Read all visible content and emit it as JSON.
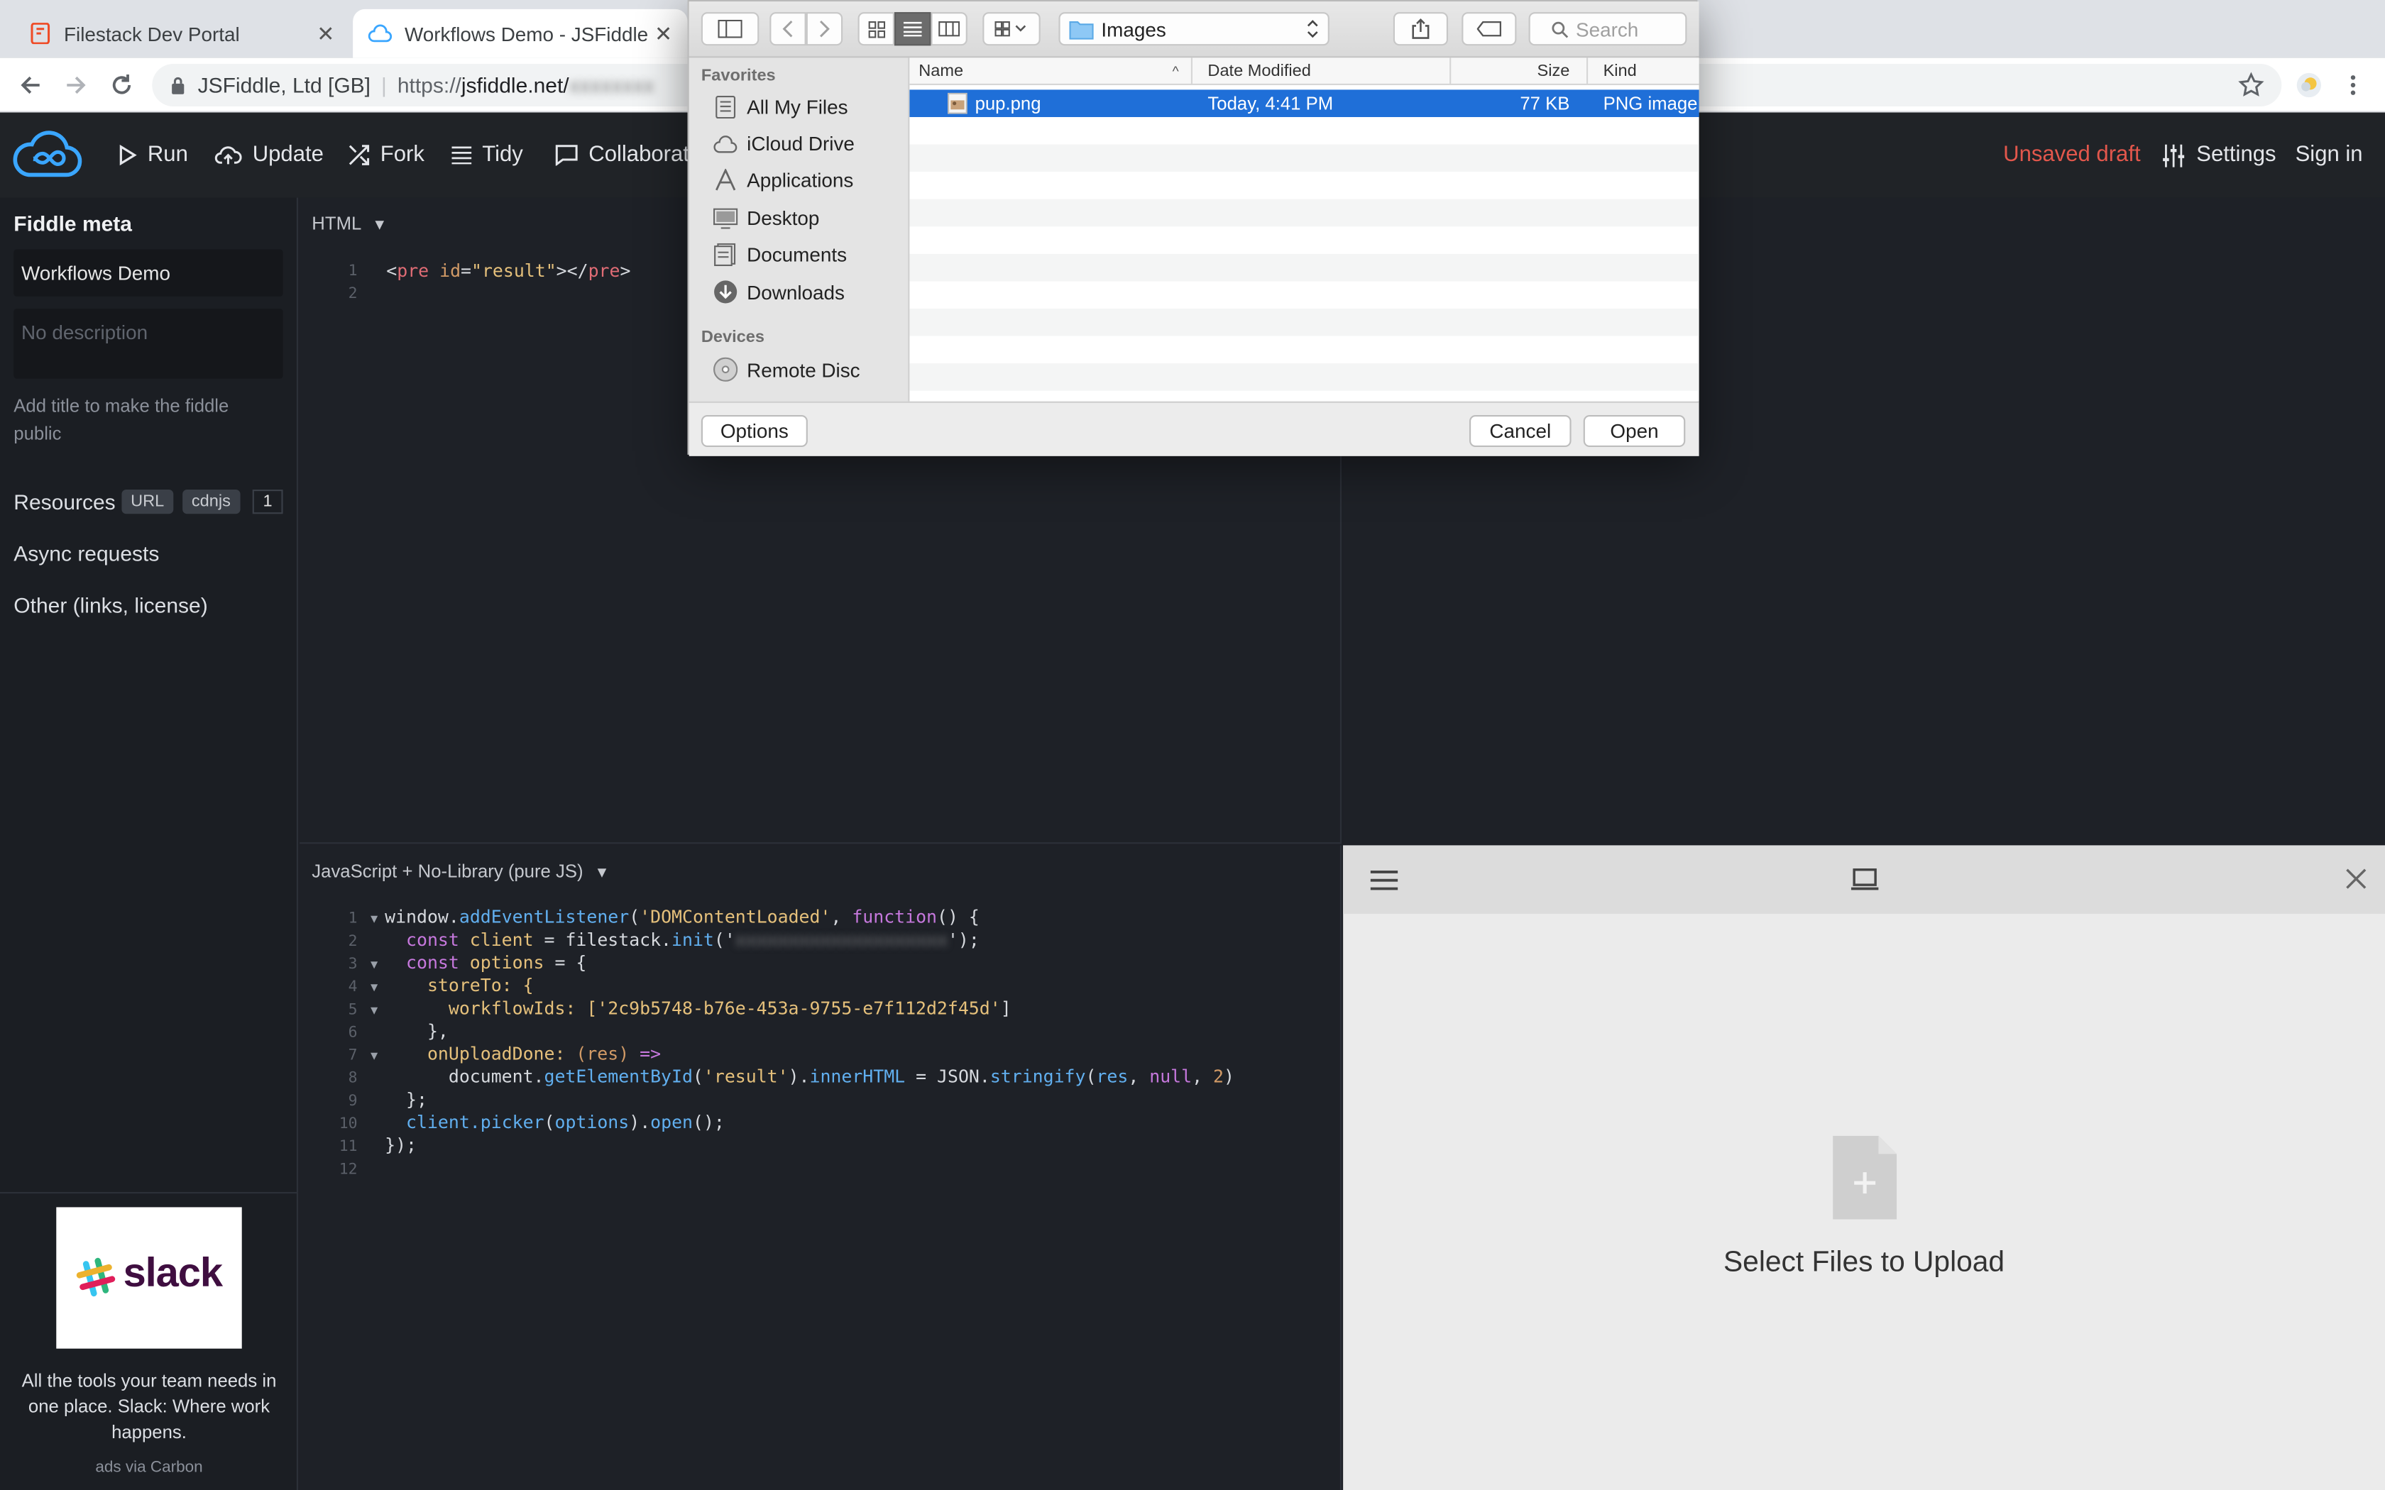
{
  "browser": {
    "tabs": [
      {
        "title": "Filestack Dev Portal",
        "active": false
      },
      {
        "title": "Workflows Demo - JSFiddle",
        "active": true
      }
    ],
    "site_identity": "JSFiddle, Ltd [GB]",
    "url_prefix": "https://",
    "url_host": "jsfiddle.net/",
    "url_path_blurred": "xxxxxxxx"
  },
  "header": {
    "run": "Run",
    "update": "Update",
    "fork": "Fork",
    "tidy": "Tidy",
    "collaborate": "Collaborate",
    "unsaved": "Unsaved draft",
    "settings": "Settings",
    "signin": "Sign in",
    "colors": {
      "unsaved": "#e2574c",
      "bg": "#202327",
      "logo": "#3aa6ff"
    }
  },
  "sidebar": {
    "title": "Fiddle meta",
    "name_value": "Workflows Demo",
    "description_placeholder": "No description",
    "hint": "Add title to make the fiddle public",
    "resources_label": "Resources",
    "url_pill": "URL",
    "cdnjs_pill": "cdnjs",
    "resources_count": "1",
    "async": "Async requests",
    "other": "Other (links, license)",
    "ad_text": "All the tools your team needs in one place. Slack: Where work happens.",
    "ad_via": "ads via Carbon",
    "ad_logo_text": "slack"
  },
  "html_panel": {
    "label": "HTML",
    "lines": [
      "1",
      "2"
    ],
    "code": {
      "open_lt": "<",
      "tag": "pre",
      "attr": " id",
      "eq": "=",
      "str": "\"result\"",
      "close": "></",
      "tag2": "pre",
      "end": ">"
    }
  },
  "js_panel": {
    "label": "JavaScript + No-Library (pure JS)",
    "line_numbers": [
      "1",
      "2",
      "3",
      "4",
      "5",
      "6",
      "7",
      "8",
      "9",
      "10",
      "11",
      "12"
    ],
    "code": {
      "l1a": "window.",
      "l1b": "addEventListener",
      "l1c": "(",
      "l1d": "'DOMContentLoaded'",
      "l1e": ", ",
      "l1f": "function",
      "l1g": "() {",
      "l2a": "  const ",
      "l2b": "client",
      "l2c": " = filestack.",
      "l2d": "init",
      "l2e": "('",
      "l2f": "xxxxxxxxxxxxxxxxxxxx",
      "l2g": "');",
      "l3a": "  const ",
      "l3b": "options",
      "l3c": " = {",
      "l4": "    storeTo: {",
      "l5a": "      workflowIds: [",
      "l5b": "'2c9b5748-b76e-453a-9755-e7f112d2f45d'",
      "l5c": "]",
      "l6": "    },",
      "l7a": "    onUploadDone: ",
      "l7b": "(res)",
      "l7c": " =>",
      "l8a": "      document.",
      "l8b": "getElementById",
      "l8c": "(",
      "l8d": "'result'",
      "l8e": ").",
      "l8f": "innerHTML",
      "l8g": " = ",
      "l8h": "JSON.",
      "l8i": "stringify",
      "l8j": "(",
      "l8k": "res",
      "l8l": ", ",
      "l8m": "null",
      "l8n": ", ",
      "l8o": "2",
      "l8p": ")",
      "l9": "  };",
      "l10a": "  client.",
      "l10b": "picker",
      "l10c": "(",
      "l10d": "options",
      "l10e": ").",
      "l10f": "open",
      "l10g": "();",
      "l11": "});"
    }
  },
  "picker": {
    "select_text": "Select Files to Upload"
  },
  "file_dialog": {
    "location": "Images",
    "search_placeholder": "Search",
    "favorites_header": "Favorites",
    "favorites": [
      "All My Files",
      "iCloud Drive",
      "Applications",
      "Desktop",
      "Documents",
      "Downloads"
    ],
    "devices_header": "Devices",
    "devices": [
      "Remote Disc"
    ],
    "columns": [
      "Name",
      "Date Modified",
      "Size",
      "Kind"
    ],
    "files": [
      {
        "name": "pup.png",
        "modified": "Today, 4:41 PM",
        "size": "77 KB",
        "kind": "PNG image",
        "selected": true
      }
    ],
    "options_button": "Options",
    "cancel_button": "Cancel",
    "open_button": "Open",
    "selection_color": "#1f6fd8"
  }
}
